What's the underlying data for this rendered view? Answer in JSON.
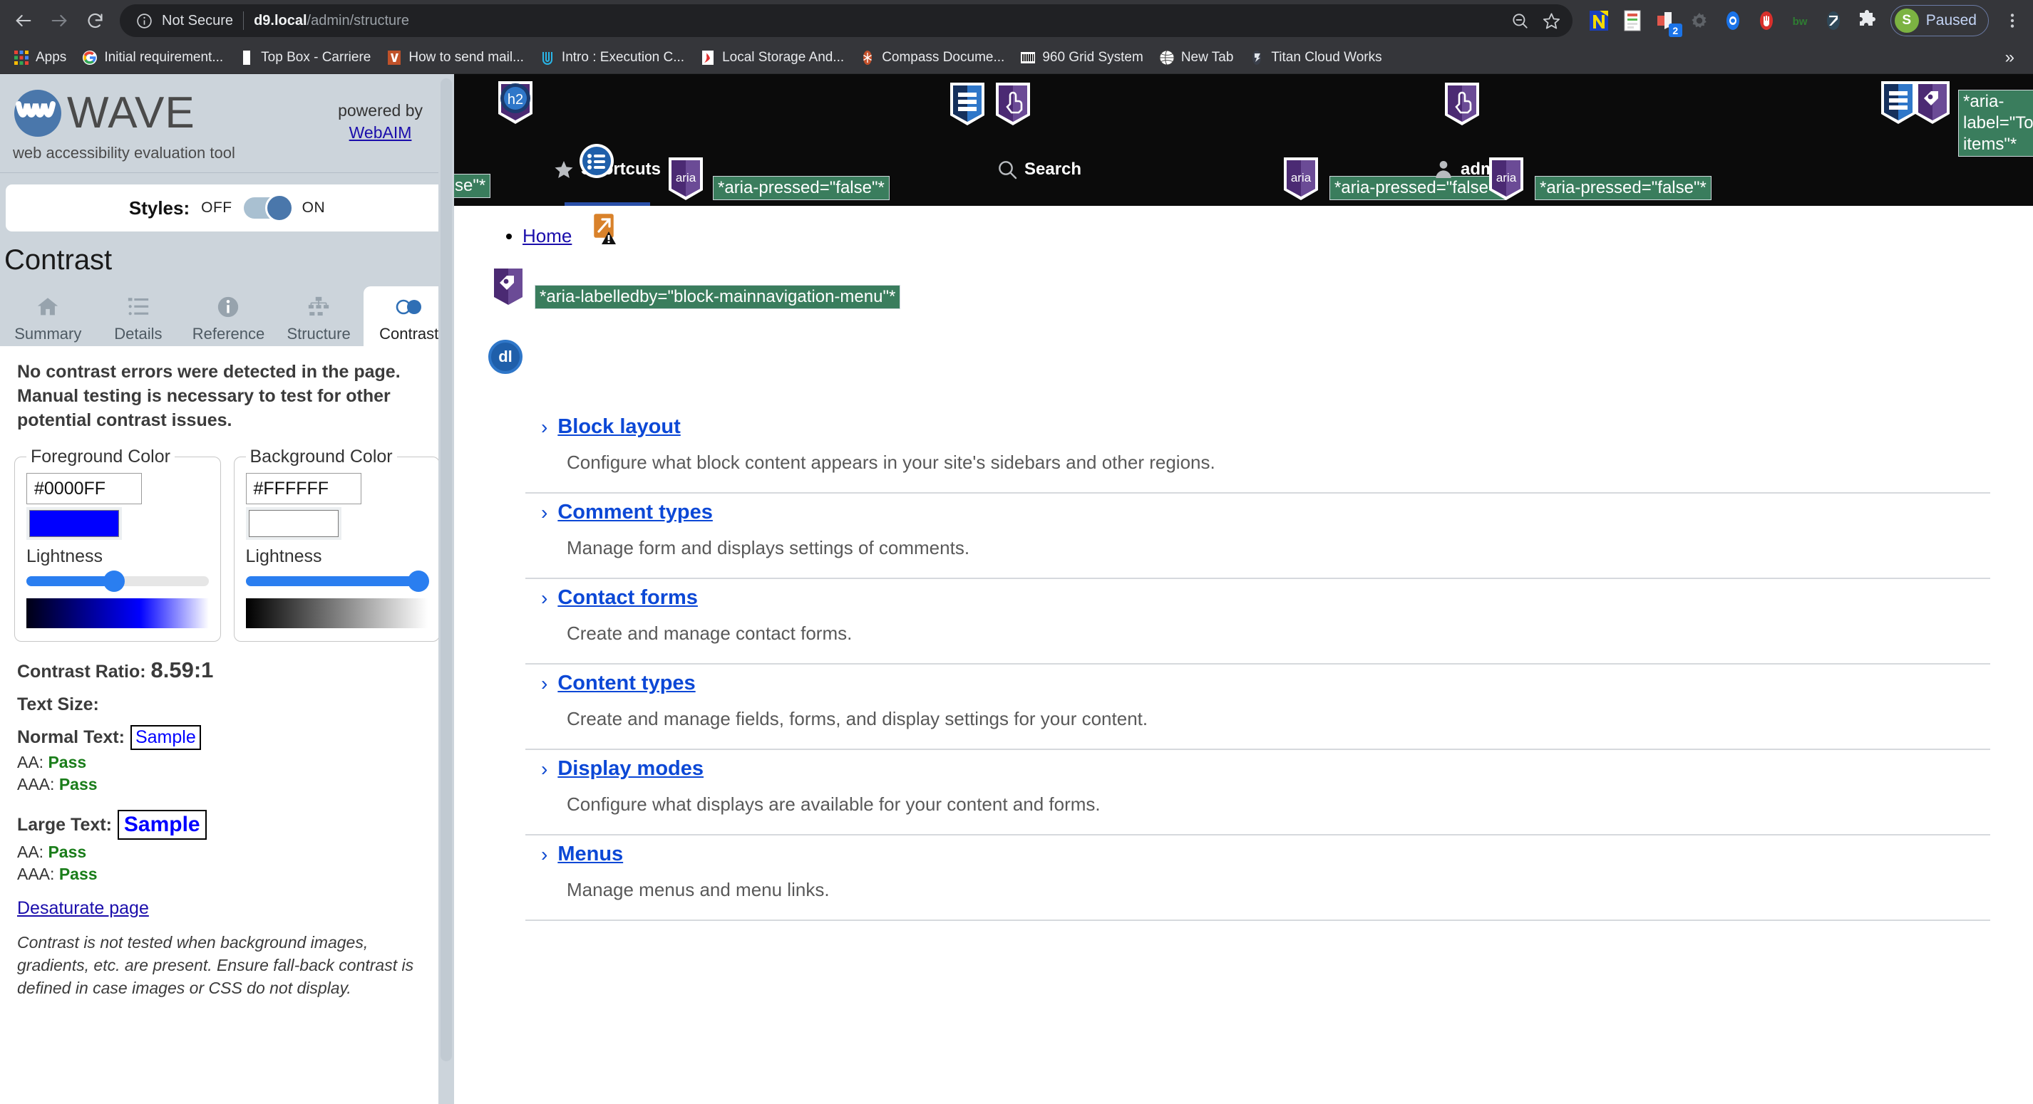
{
  "browser": {
    "nav": {
      "back_icon": "back-arrow-icon",
      "forward_icon": "forward-arrow-icon",
      "reload_icon": "reload-icon"
    },
    "omnibox": {
      "info_icon": "info-circle-icon",
      "security_text": "Not Secure",
      "url_host": "d9.local",
      "url_path": "/admin/structure",
      "zoom_icon": "zoom-out-icon",
      "bookmark_icon": "star-outline-icon"
    },
    "extensions": [
      {
        "name": "notion-extension",
        "letter": "N"
      },
      {
        "name": "form-filler-extension",
        "letter": ""
      },
      {
        "name": "video-downloader-extension",
        "letter": "",
        "badge": "2"
      },
      {
        "name": "settings-gear-extension",
        "letter": ""
      },
      {
        "name": "eye-tracker-extension",
        "letter": ""
      },
      {
        "name": "adblock-stop-extension",
        "letter": ""
      },
      {
        "name": "bitwarden-extension",
        "letter": "bw"
      },
      {
        "name": "wave-extension",
        "letter": ""
      },
      {
        "name": "extensions-puzzle-icon",
        "letter": ""
      }
    ],
    "profile": {
      "avatar_letter": "S",
      "label": "Paused"
    },
    "menu_icon": "kebab-menu-icon"
  },
  "bookmarks": {
    "apps_label": "Apps",
    "items": [
      {
        "label": "Initial requirement...",
        "icon": "google-icon"
      },
      {
        "label": "Top Box - Carriere",
        "icon": "document-icon"
      },
      {
        "label": "How to send mail...",
        "icon": "vimeo-icon"
      },
      {
        "label": "Intro : Execution C...",
        "icon": "clip-icon"
      },
      {
        "label": "Local Storage And...",
        "icon": "stackoverflow-icon"
      },
      {
        "label": "Compass Docume...",
        "icon": "compass-icon"
      },
      {
        "label": "960 Grid System",
        "icon": "grid-icon"
      },
      {
        "label": "New Tab",
        "icon": "globe-icon"
      },
      {
        "label": "Titan Cloud Works",
        "icon": "titan-icon"
      }
    ],
    "overflow_label": "»"
  },
  "wave": {
    "wordmark": "WAVE",
    "tagline": "web accessibility evaluation tool",
    "powered_by": "powered by",
    "powered_link": "WebAIM",
    "styles": {
      "label": "Styles:",
      "off_label": "OFF",
      "on_label": "ON",
      "state": "ON"
    },
    "panel_title": "Contrast",
    "tabs": [
      {
        "label": "Summary",
        "icon": "home-icon",
        "active": false
      },
      {
        "label": "Details",
        "icon": "list-icon",
        "active": false
      },
      {
        "label": "Reference",
        "icon": "info-icon",
        "active": false
      },
      {
        "label": "Structure",
        "icon": "sitemap-icon",
        "active": false
      },
      {
        "label": "Contrast",
        "icon": "contrast-circles-icon",
        "active": true
      }
    ],
    "contrast": {
      "message": "No contrast errors were detected in the page. Manual testing is necessary to test for other potential contrast issues.",
      "foreground": {
        "legend": "Foreground Color",
        "hex": "#0000FF",
        "swatch_color": "#0000FF",
        "lightness_label": "Lightness",
        "slider_percent": 48,
        "gradient_from": "#000014",
        "gradient_mid": "#0000FF",
        "gradient_to": "#FFFFFF"
      },
      "background": {
        "legend": "Background Color",
        "hex": "#FFFFFF",
        "swatch_color": "#FFFFFF",
        "lightness_label": "Lightness",
        "slider_percent": 95,
        "gradient_from": "#000000",
        "gradient_mid": "#808080",
        "gradient_to": "#FFFFFF"
      },
      "ratio_label": "Contrast Ratio:",
      "ratio_value": "8.59:1",
      "text_size_label": "Text Size:",
      "normal_text_label": "Normal Text:",
      "normal_sample": "Sample",
      "normal_aa_label": "AA:",
      "normal_aa_value": "Pass",
      "normal_aaa_label": "AAA:",
      "normal_aaa_value": "Pass",
      "large_text_label": "Large Text:",
      "large_sample": "Sample",
      "large_aa_label": "AA:",
      "large_aa_value": "Pass",
      "large_aaa_label": "AAA:",
      "large_aaa_value": "Pass",
      "desaturate_link": "Desaturate page",
      "note": "Contrast is not tested when background images, gradients, etc. are present. Ensure fall-back contrast is defined in case images or CSS do not display."
    }
  },
  "drupal_toolbar": {
    "items": [
      {
        "label": "Shortcuts",
        "icon": "shortcuts-list-icon",
        "active": true
      },
      {
        "label": "Search",
        "icon": "magnifier-icon",
        "active": false
      },
      {
        "label": "admin",
        "icon": "person-icon",
        "active": false
      }
    ],
    "wave_annotations": [
      {
        "badge": "h2-heading-badge",
        "text": ""
      },
      {
        "badge": "aria-badge",
        "text": "*aria-pressed=\"false\"*"
      },
      {
        "badge": "aria-badge",
        "text": "*aria-pressed=\"false\"*"
      },
      {
        "badge": "aria-badge",
        "text": "*aria-pressed=\"false\"*"
      },
      {
        "badge": "label-badge",
        "text": "*aria-label=\"Toolbar items\"*"
      }
    ],
    "truncated_left_label": "se\"*"
  },
  "main": {
    "breadcrumb_home": "Home",
    "nav_region_annotation": "*aria-labelledby=\"block-mainnavigation-menu\"*",
    "dl_badge": "dl",
    "structure_items": [
      {
        "title": "Block layout",
        "description": "Configure what block content appears in your site's sidebars and other regions."
      },
      {
        "title": "Comment types",
        "description": "Manage form and displays settings of comments."
      },
      {
        "title": "Contact forms",
        "description": "Create and manage contact forms."
      },
      {
        "title": "Content types",
        "description": "Create and manage fields, forms, and display settings for your content."
      },
      {
        "title": "Display modes",
        "description": "Configure what displays are available for your content and forms."
      },
      {
        "title": "Menus",
        "description": "Manage menus and menu links."
      }
    ]
  },
  "colors": {
    "chrome_bg": "#35363a",
    "omnibox_bg": "#202124",
    "link_blue": "#0c48d6",
    "wave_green_tag": "#3a7d5d",
    "wave_sidebar_bg": "#ccd4db",
    "accent_blue": "#2a7ef0",
    "pass_green": "#1a7d1a"
  }
}
